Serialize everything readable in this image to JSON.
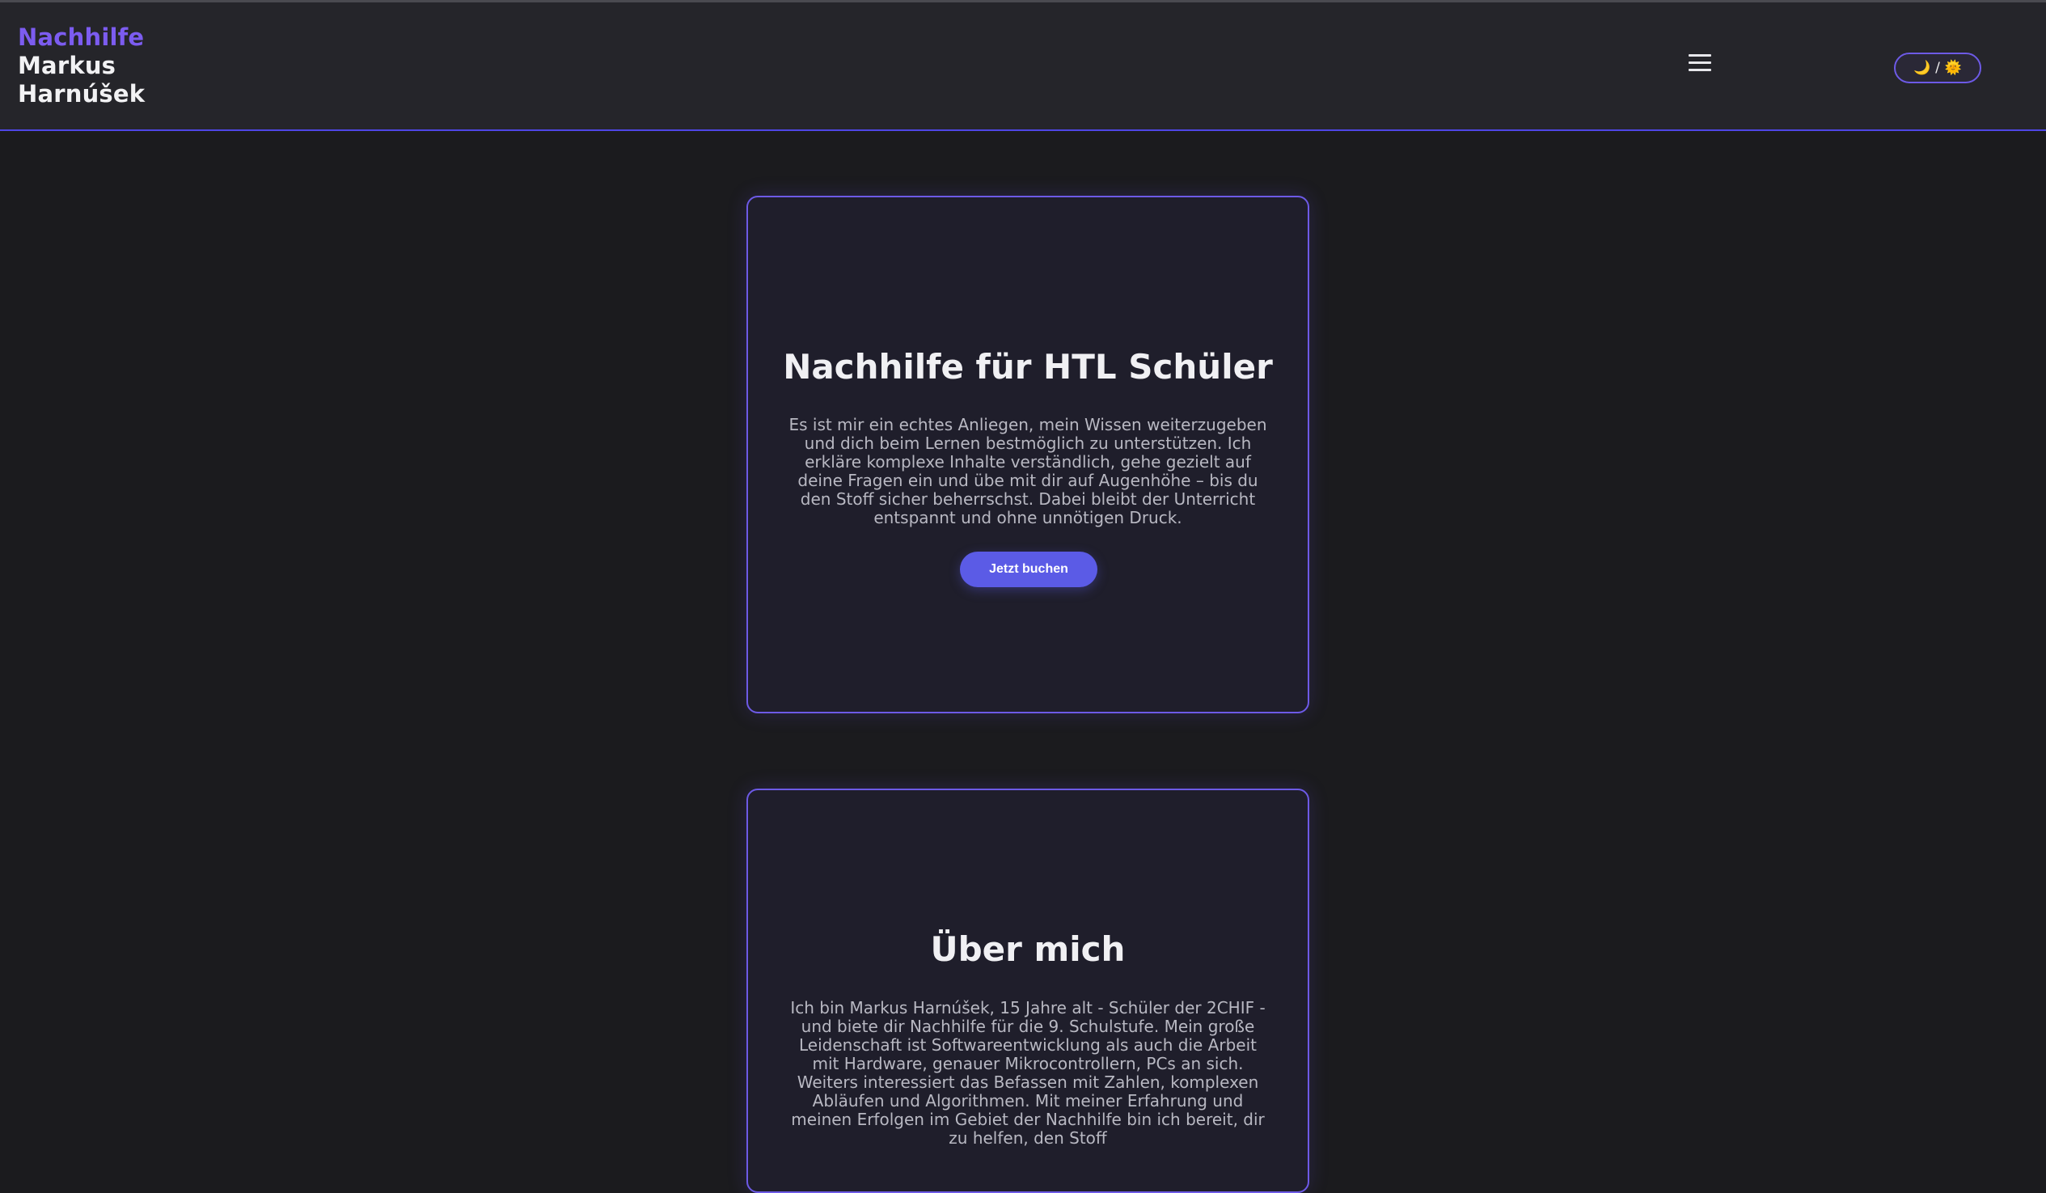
{
  "header": {
    "brand_accent": "Nachhilfe",
    "brand_line2": "Markus",
    "brand_line3": "Harnúšek",
    "menu_icon": "hamburger-icon",
    "theme_toggle": {
      "moon": "🌙",
      "separator": "/",
      "sun": "🌞"
    }
  },
  "hero": {
    "title": "Nachhilfe für HTL Schüler",
    "text": "Es ist mir ein echtes Anliegen, mein Wissen weiterzugeben und dich beim Lernen bestmöglich zu unterstützen. Ich erkläre komplexe Inhalte verständlich, gehe gezielt auf deine Fragen ein und übe mit dir auf Augenhöhe – bis du den Stoff sicher beherrschst. Dabei bleibt der Unterricht entspannt und ohne unnötigen Druck.",
    "button_label": "Jetzt buchen"
  },
  "about": {
    "title": "Über mich",
    "text": "Ich bin Markus Harnúšek, 15 Jahre alt - Schüler der 2CHIF - und biete dir Nachhilfe für die 9. Schulstufe. Mein große Leidenschaft ist Softwareentwicklung als auch die Arbeit mit Hardware, genauer Mikrocontrollern, PCs an sich. Weiters interessiert das Befassen mit Zahlen, komplexen Abläufen und Algorithmen. Mit meiner Erfahrung und meinen Erfolgen im Gebiet der Nachhilfe bin ich bereit, dir zu helfen, den Stoff"
  },
  "colors": {
    "accent": "#7c5cf0",
    "button": "#5b5be6",
    "background": "#1b1b1e",
    "header_bg": "#25252a",
    "card_bg": "#1f1e2b",
    "card_border": "#6d5ae6"
  }
}
